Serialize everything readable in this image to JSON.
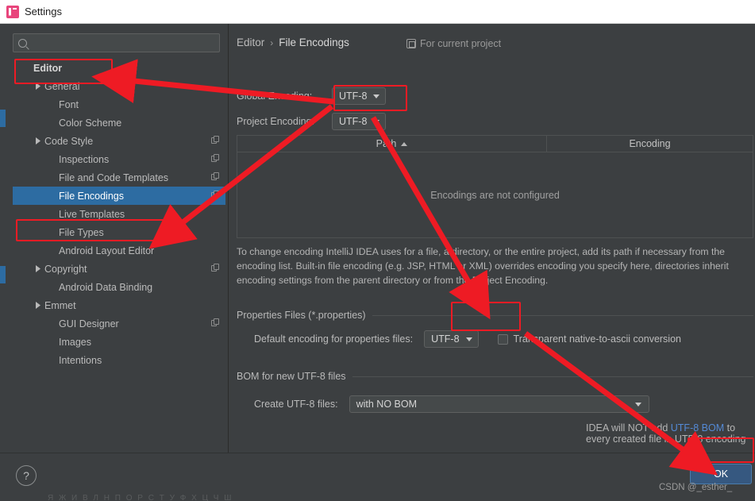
{
  "window": {
    "title": "Settings",
    "app_icon": "intellij-idea-icon"
  },
  "search": {
    "placeholder": "",
    "value": "",
    "icon": "search-icon"
  },
  "sidebar": {
    "items": [
      {
        "label": "Editor",
        "indent": 0,
        "arrow": "none",
        "bold": true,
        "selected": false,
        "copy": false
      },
      {
        "label": "General",
        "indent": 1,
        "arrow": "right",
        "bold": false,
        "selected": false,
        "copy": false
      },
      {
        "label": "Font",
        "indent": 2,
        "arrow": "none",
        "bold": false,
        "selected": false,
        "copy": false
      },
      {
        "label": "Color Scheme",
        "indent": 2,
        "arrow": "none",
        "bold": false,
        "selected": false,
        "copy": false
      },
      {
        "label": "Code Style",
        "indent": 1,
        "arrow": "right",
        "bold": false,
        "selected": false,
        "copy": true
      },
      {
        "label": "Inspections",
        "indent": 2,
        "arrow": "none",
        "bold": false,
        "selected": false,
        "copy": true
      },
      {
        "label": "File and Code Templates",
        "indent": 2,
        "arrow": "none",
        "bold": false,
        "selected": false,
        "copy": true
      },
      {
        "label": "File Encodings",
        "indent": 2,
        "arrow": "none",
        "bold": false,
        "selected": true,
        "copy": true
      },
      {
        "label": "Live Templates",
        "indent": 2,
        "arrow": "none",
        "bold": false,
        "selected": false,
        "copy": false
      },
      {
        "label": "File Types",
        "indent": 2,
        "arrow": "none",
        "bold": false,
        "selected": false,
        "copy": false
      },
      {
        "label": "Android Layout Editor",
        "indent": 2,
        "arrow": "none",
        "bold": false,
        "selected": false,
        "copy": false
      },
      {
        "label": "Copyright",
        "indent": 1,
        "arrow": "right",
        "bold": false,
        "selected": false,
        "copy": true
      },
      {
        "label": "Android Data Binding",
        "indent": 2,
        "arrow": "none",
        "bold": false,
        "selected": false,
        "copy": false
      },
      {
        "label": "Emmet",
        "indent": 1,
        "arrow": "right",
        "bold": false,
        "selected": false,
        "copy": false
      },
      {
        "label": "GUI Designer",
        "indent": 2,
        "arrow": "none",
        "bold": false,
        "selected": false,
        "copy": true
      },
      {
        "label": "Images",
        "indent": 2,
        "arrow": "none",
        "bold": false,
        "selected": false,
        "copy": false
      },
      {
        "label": "Intentions",
        "indent": 2,
        "arrow": "none",
        "bold": false,
        "selected": false,
        "copy": false
      }
    ]
  },
  "breadcrumb": {
    "parent": "Editor",
    "separator": "›",
    "current": "File Encodings"
  },
  "scope": {
    "label": "For current project",
    "icon": "project-scope-icon"
  },
  "encodings": {
    "global_label": "Global Encoding:",
    "global_value": "UTF-8",
    "project_label": "Project Encoding:",
    "project_value": "UTF-8"
  },
  "table": {
    "columns": [
      "Path",
      "Encoding"
    ],
    "sort_column": "Path",
    "sort_direction": "asc",
    "empty_message": "Encodings are not configured",
    "rows": []
  },
  "help_text": "To change encoding IntelliJ IDEA uses for a file, a directory, or the entire project, add its path if necessary from the encoding list. Built-in file encoding (e.g. JSP, HTML or XML) overrides encoding you specify here, directories inherit encoding settings from the parent directory or from the Project Encoding.",
  "properties_section": {
    "title": "Properties Files (*.properties)",
    "default_encoding_label": "Default encoding for properties files:",
    "default_encoding_value": "UTF-8",
    "transparent_label": "Transparent native-to-ascii conversion",
    "transparent_checked": false
  },
  "bom_section": {
    "title": "BOM for new UTF-8 files",
    "create_label": "Create UTF-8 files:",
    "create_value": "with NO BOM",
    "note_prefix": "IDEA will NOT add ",
    "note_link": "UTF-8 BOM",
    "note_suffix": " to every created file in UTF-8 encoding"
  },
  "footer": {
    "help_label": "?",
    "ok_label": "OK"
  },
  "watermark": "CSDN @_esther_",
  "ghost_strip": "Я Ж И В Л Н П О Р С Т У Ф Х Ц Ч Ш",
  "annotations": {
    "accent_color": "#ee1b24",
    "boxes": [
      "editor-tree-item",
      "file-encodings-tree-item",
      "project-encoding-combo",
      "properties-encoding-combo",
      "ok-button"
    ],
    "arrows": [
      "project-encoding-to-editor-tree",
      "project-encoding-to-file-encodings-tree",
      "project-encoding-to-properties-encoding",
      "properties-encoding-to-ok"
    ]
  }
}
